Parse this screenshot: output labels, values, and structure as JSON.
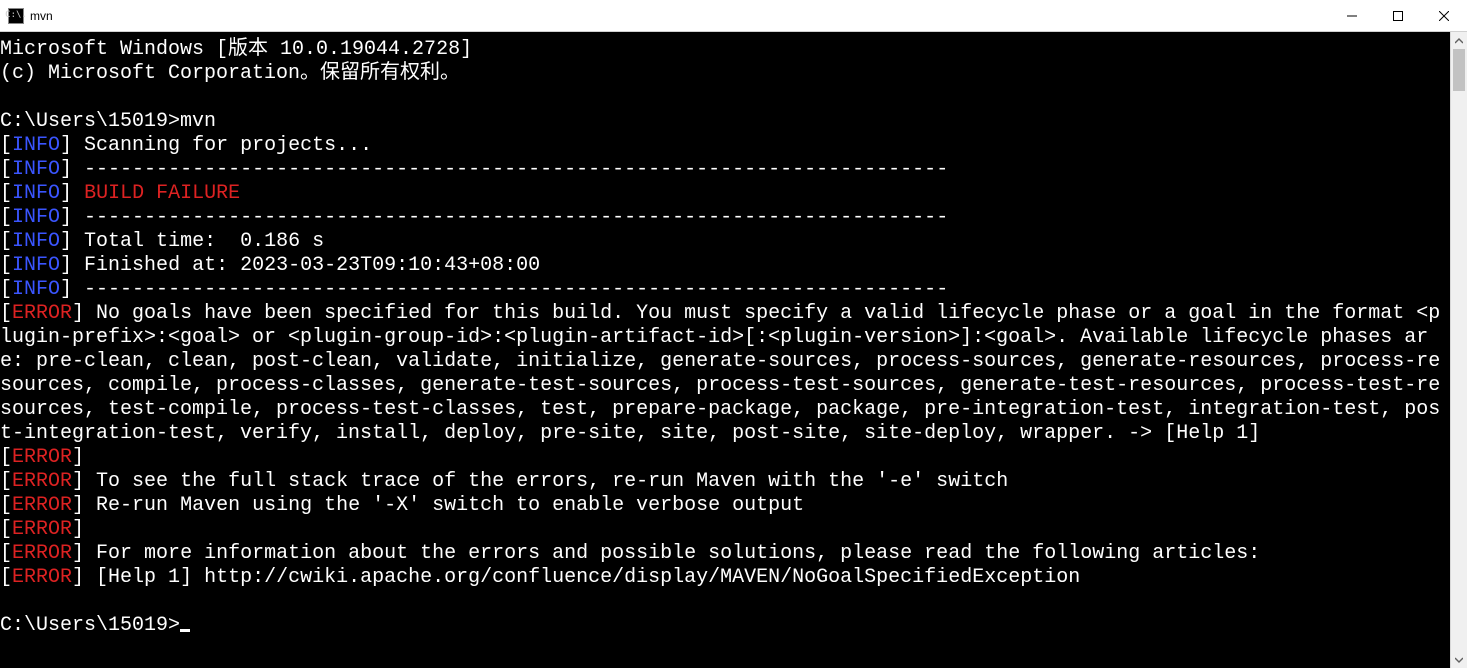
{
  "window": {
    "title": "mvn",
    "icon_label": "C:\\."
  },
  "terminal": {
    "header1": "Microsoft Windows [版本 10.0.19044.2728]",
    "header2": "(c) Microsoft Corporation。保留所有权利。",
    "prompt_path": "C:\\Users\\15019>",
    "command": "mvn",
    "separator": "------------------------------------------------------------------------",
    "lines": {
      "scanning": "Scanning for projects...",
      "build_failure": "BUILD FAILURE",
      "total_time": "Total time:  0.186 s",
      "finished_at": "Finished at: 2023-03-23T09:10:43+08:00",
      "err_main": "No goals have been specified for this build. You must specify a valid lifecycle phase or a goal in the format <plugin-prefix>:<goal> or <plugin-group-id>:<plugin-artifact-id>[:<plugin-version>]:<goal>. Available lifecycle phases are: pre-clean, clean, post-clean, validate, initialize, generate-sources, process-sources, generate-resources, process-resources, compile, process-classes, generate-test-sources, process-test-sources, generate-test-resources, process-test-resources, test-compile, process-test-classes, test, prepare-package, package, pre-integration-test, integration-test, post-integration-test, verify, install, deploy, pre-site, site, post-site, site-deploy, wrapper. -> [Help 1]",
      "err_trace": "To see the full stack trace of the errors, re-run Maven with the '-e' switch",
      "err_x": "Re-run Maven using the '-X' switch to enable verbose output",
      "err_moreinfo": "For more information about the errors and possible solutions, please read the following articles:",
      "err_help1": "[Help 1] http://cwiki.apache.org/confluence/display/MAVEN/NoGoalSpecifiedException"
    },
    "tags": {
      "info": "INFO",
      "error": "ERROR"
    }
  }
}
